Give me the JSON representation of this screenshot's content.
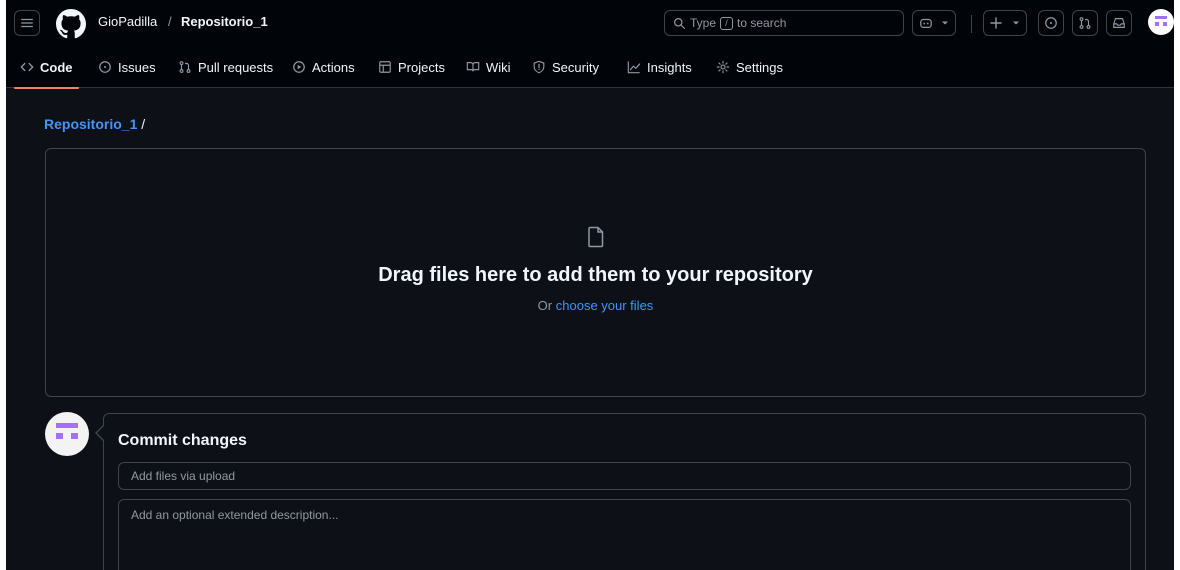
{
  "header": {
    "owner": "GioPadilla",
    "separator": "/",
    "repo": "Repositorio_1",
    "search": {
      "prefix": "Type",
      "key": "/",
      "suffix": "to search"
    }
  },
  "tabs": [
    {
      "label": "Code",
      "icon": "code-icon",
      "active": true
    },
    {
      "label": "Issues",
      "icon": "issue-icon"
    },
    {
      "label": "Pull requests",
      "icon": "pull-request-icon"
    },
    {
      "label": "Actions",
      "icon": "play-icon"
    },
    {
      "label": "Projects",
      "icon": "table-icon"
    },
    {
      "label": "Wiki",
      "icon": "book-icon"
    },
    {
      "label": "Security",
      "icon": "shield-icon"
    },
    {
      "label": "Insights",
      "icon": "graph-icon"
    },
    {
      "label": "Settings",
      "icon": "gear-icon"
    }
  ],
  "breadcrumb": {
    "repo": "Repositorio_1",
    "slash": "/"
  },
  "dropzone": {
    "title": "Drag files here to add them to your repository",
    "sub_prefix": "Or",
    "sub_link": "choose your files"
  },
  "commit": {
    "title": "Commit changes",
    "summary_placeholder": "Add files via upload",
    "description_placeholder": "Add an optional extended description..."
  },
  "colors": {
    "accent": "#4493f8",
    "tab_underline": "#f78166",
    "avatar": "#a371f7"
  }
}
